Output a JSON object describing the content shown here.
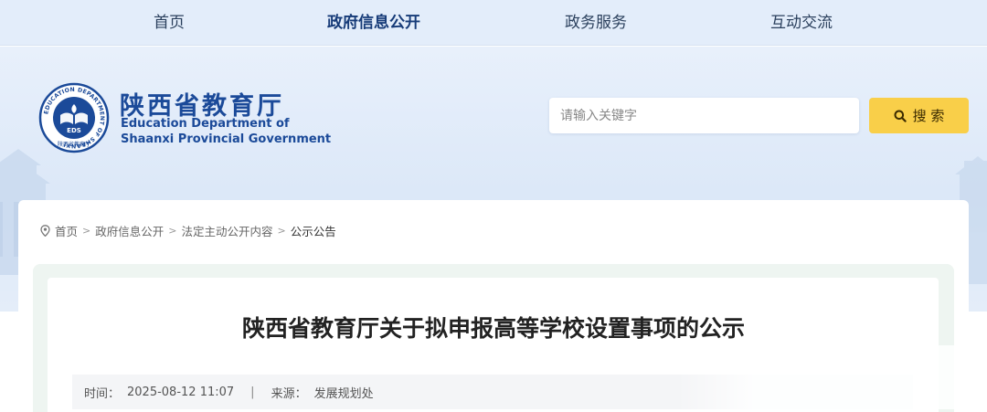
{
  "nav": {
    "items": [
      {
        "label": "首页"
      },
      {
        "label": "政府信息公开"
      },
      {
        "label": "政务服务"
      },
      {
        "label": "互动交流"
      }
    ],
    "active_index": 1
  },
  "header": {
    "logo_cn": "陕西省教育厅",
    "logo_en_line1": "Education Department of",
    "logo_en_line2": "Shaanxi Provincial Government",
    "emblem": {
      "ring_text": "EDUCATION DEPARTMENT OF SHAANXI",
      "ring_text_cn": "陕西省教育厅",
      "center_text": "EDS"
    }
  },
  "search": {
    "placeholder": "请输入关键字",
    "button_label": "搜 索"
  },
  "breadcrumb": {
    "items": [
      "首页",
      "政府信息公开",
      "法定主动公开内容",
      "公示公告"
    ]
  },
  "article": {
    "title": "陕西省教育厅关于拟申报高等学校设置事项的公示",
    "time_label": "时间：",
    "time_value": "2025-08-12 11:07",
    "separator": "|",
    "source_label": "来源：",
    "source_value": "发展规划处"
  },
  "colors": {
    "nav_bg": "#e3edfa",
    "brand_blue": "#1b4a99",
    "search_button": "#f9cf49",
    "article_panel": "#eef5f1"
  }
}
